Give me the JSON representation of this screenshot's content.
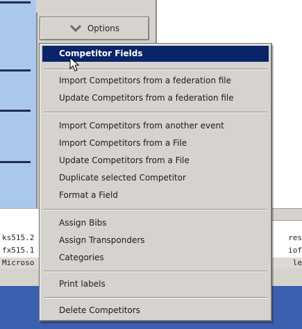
{
  "toolbar": {
    "options_label": "Options"
  },
  "menu": {
    "items": [
      {
        "label": "Competitor Fields"
      },
      {
        "label": "Import Competitors from a federation file"
      },
      {
        "label": "Update Competitors from a federation file"
      },
      {
        "label": "Import Competitors from another event"
      },
      {
        "label": "Import Competitors from a File"
      },
      {
        "label": "Update Competitors from a File"
      },
      {
        "label": "Duplicate selected Competitor"
      },
      {
        "label": "Format a Field"
      },
      {
        "label": "Assign Bibs"
      },
      {
        "label": "Assign Transponders"
      },
      {
        "label": "Categories"
      },
      {
        "label": "Print labels"
      },
      {
        "label": "Delete Competitors"
      }
    ],
    "highlight_color": "#0a246a"
  },
  "background": {
    "rows": [
      {
        "left": "ks515.2",
        "right": "res"
      },
      {
        "left": "fx515.1",
        "right": "iof"
      },
      {
        "left": "Microso",
        "right": "le"
      }
    ]
  },
  "icons": {
    "options_chevron": "chevron-down-icon",
    "pointer": "mouse-pointer-icon"
  }
}
